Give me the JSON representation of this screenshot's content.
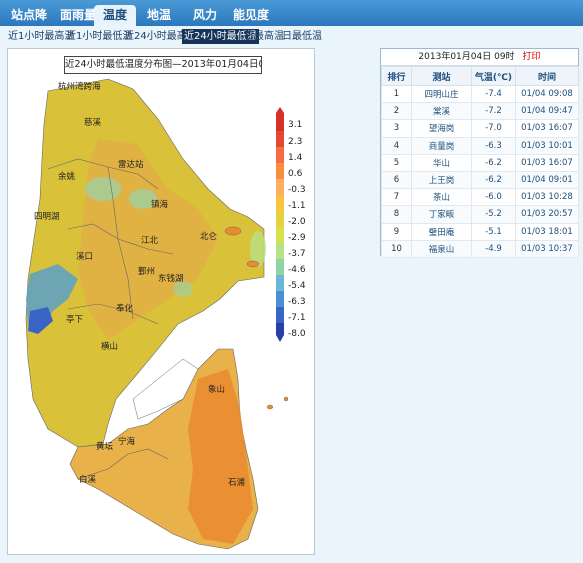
{
  "tabs": [
    {
      "label": "站点降水"
    },
    {
      "label": "面雨量"
    },
    {
      "label": "温度"
    },
    {
      "label": "地温"
    },
    {
      "label": "风力"
    },
    {
      "label": "能见度"
    }
  ],
  "subtabs": [
    {
      "label": "近1小时最高温"
    },
    {
      "label": "近1小时最低温"
    },
    {
      "label": "近24小时最高温"
    },
    {
      "label": "近24小时最低温"
    },
    {
      "label": "日最高温"
    },
    {
      "label": "日最低温"
    }
  ],
  "map": {
    "title": "近24小时最低温度分布图—2013年01月04日08时",
    "places": [
      "杭州湾跨海",
      "慈溪",
      "余姚",
      "四明湖",
      "溪口",
      "亭下",
      "镇海",
      "北仑",
      "鄞州",
      "江北",
      "东钱湖",
      "奉化",
      "横山",
      "宁海",
      "黄坛",
      "白溪",
      "象山",
      "石浦",
      "雷达站"
    ],
    "legend": [
      "3.1",
      "2.3",
      "1.4",
      "0.6",
      "-0.3",
      "-1.1",
      "-2.0",
      "-2.9",
      "-3.7",
      "-4.6",
      "-5.4",
      "-6.3",
      "-7.1",
      "-8.0"
    ],
    "legend_colors": [
      "#d73027",
      "#e34a33",
      "#f46d43",
      "#f88e3f",
      "#fdae61",
      "#f7c53f",
      "#e6d240",
      "#d9e04a",
      "#b8e186",
      "#8fd3a6",
      "#69b8d4",
      "#4a90d0",
      "#3a64c4",
      "#2b3fa8"
    ]
  },
  "panel": {
    "title": "2013年01月04日 09时",
    "print_label": "打印",
    "headers": [
      "排行",
      "测站",
      "气温(℃)",
      "时间"
    ],
    "rows": [
      [
        "1",
        "四明山庄",
        "-7.4",
        "01/04 09:08"
      ],
      [
        "2",
        "棠溪",
        "-7.2",
        "01/04 09:47"
      ],
      [
        "3",
        "望海岗",
        "-7.0",
        "01/03 16:07"
      ],
      [
        "4",
        "商量岗",
        "-6.3",
        "01/03 10:01"
      ],
      [
        "5",
        "华山",
        "-6.2",
        "01/03 16:07"
      ],
      [
        "6",
        "上王岗",
        "-6.2",
        "01/04 09:01"
      ],
      [
        "7",
        "茶山",
        "-6.0",
        "01/03 10:28"
      ],
      [
        "8",
        "丁家畈",
        "-5.2",
        "01/03 20:57"
      ],
      [
        "9",
        "璧田庵",
        "-5.1",
        "01/03 18:01"
      ],
      [
        "10",
        "福泉山",
        "-4.9",
        "01/03 10:37"
      ]
    ]
  }
}
